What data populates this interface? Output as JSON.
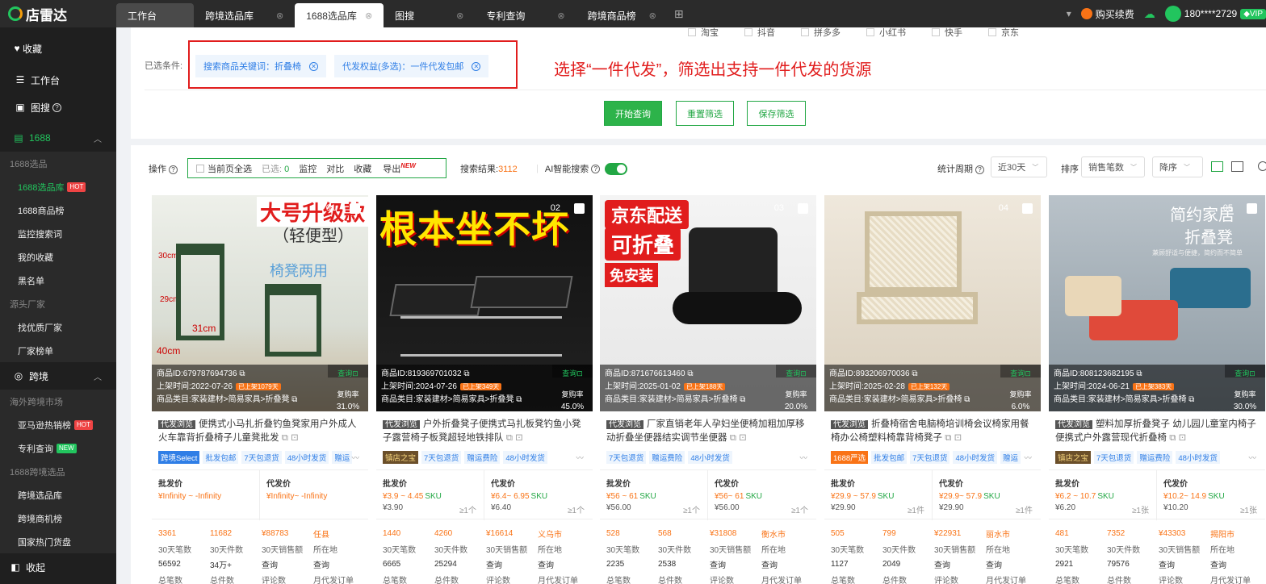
{
  "app": {
    "name": "店雷达"
  },
  "tabs": [
    {
      "label": "工作台"
    },
    {
      "label": "跨境选品库"
    },
    {
      "label": "1688选品库"
    },
    {
      "label": "图搜"
    },
    {
      "label": "专利查询"
    },
    {
      "label": "跨境商品榜"
    }
  ],
  "topright": {
    "buy": "购买续费",
    "phone": "180****2729"
  },
  "sidebar": {
    "fav": "收藏",
    "workbench": "工作台",
    "imgsearch": "图搜",
    "s1688": "1688",
    "g1": "1688选品",
    "i1": "1688选品库",
    "i2": "1688商品榜",
    "i3": "监控搜索词",
    "i4": "我的收藏",
    "i5": "黑名单",
    "g2": "源头厂家",
    "i6": "找优质厂家",
    "i7": "厂家榜单",
    "cross": "跨境",
    "g3": "海外跨境市场",
    "i8": "亚马逊热销榜",
    "i9": "专利查询",
    "g4": "1688跨境选品",
    "i10": "跨境选品库",
    "i11": "跨境商机榜",
    "i12": "国家热门货盘",
    "collapse": "收起",
    "hot": "HOT",
    "new": "NEW"
  },
  "filter": {
    "platforms": [
      "淘宝",
      "抖音",
      "拼多多",
      "小红书",
      "快手",
      "京东"
    ],
    "selected_label": "已选条件:",
    "chip1": "搜索商品关键词：折叠椅",
    "chip2": "代发权益(多选)：一件代发包邮",
    "annotation": "选择“一件代发”，筛选出支持一件代发的货源",
    "btn_query": "开始查询",
    "btn_reset": "重置筛选",
    "btn_save": "保存筛选"
  },
  "toolbar": {
    "op": "操作",
    "selectall": "当前页全选",
    "selected": "已选:",
    "selected_count": "0",
    "monitor": "监控",
    "compare": "对比",
    "fav": "收藏",
    "export": "导出",
    "new": "NEW",
    "result_label": "搜索结果:",
    "result_count": "3112",
    "ai": "AI智能搜索",
    "period": "统计周期",
    "period_val": "近30天",
    "sort": "排序",
    "sort_val": "销售笔数",
    "order_val": "降序"
  },
  "labels": {
    "pid": "商品ID:",
    "date": "上架时间:",
    "cat": "商品类目:",
    "query": "查询",
    "rate": "复购率",
    "wholesale": "批发价",
    "dropship": "代发价",
    "l_orders": "30天笔数",
    "l_pieces": "30天件数",
    "l_sales": "30天销售额",
    "l_loc": "所在地",
    "l_total": "总笔数",
    "l_totalpcs": "总件数",
    "l_reviews": "评论数",
    "l_monthly": "月代发订单"
  },
  "products": [
    {
      "idx": "01",
      "id": "679787694736",
      "date": "2022-07-26",
      "days": "已上架1079天",
      "cat": "家装建材>简易家具>折叠凳",
      "rate": "31.0%",
      "tag": "代发浏览",
      "title": "便携式小马扎折叠钓鱼凳家用户外成人火车靠背折叠椅子儿童凳批发",
      "tags": [
        "跨境Select",
        "批发包邮",
        "7天包退货",
        "48小时发货",
        "赠运"
      ],
      "wp": "¥Infinity ~ -Infinity",
      "wsku": "",
      "wu": "",
      "wm": "",
      "dp": "¥Infinity~ -Infinity",
      "dsku": "",
      "du": "",
      "dm": "",
      "o": "3361",
      "p": "11682",
      "s": "¥88783",
      "loc": "任县",
      "to": "56592",
      "tp": "34万+",
      "rv": "查询",
      "mo": "查询"
    },
    {
      "idx": "02",
      "id": "819369701032",
      "date": "2024-07-26",
      "days": "已上架349天",
      "cat": "家装建材>简易家具>折叠凳",
      "rate": "45.0%",
      "tag": "代发浏览",
      "title": "户外折叠凳子便携式马扎板凳钓鱼小凳子露营椅子板凳超轻地铁排队",
      "tags": [
        "镇店之宝",
        "7天包退货",
        "赠运费险",
        "48小时发货"
      ],
      "wp": "¥3.9 ~ 4.45",
      "wsku": "SKU",
      "wu": "¥3.90",
      "wm": "≥1个",
      "dp": "¥6.4~ 6.95",
      "dsku": "SKU",
      "du": "¥6.40",
      "dm": "≥1个",
      "o": "1440",
      "p": "4260",
      "s": "¥16614",
      "loc": "义乌市",
      "to": "6665",
      "tp": "25294",
      "rv": "查询",
      "mo": "查询"
    },
    {
      "idx": "03",
      "id": "871676613460",
      "date": "2025-01-02",
      "days": "已上架188天",
      "cat": "家装建材>简易家具>折叠椅",
      "rate": "20.0%",
      "tag": "代发浏览",
      "title": "厂家直销老年人孕妇坐便椅加粗加厚移动折叠坐便器结实调节坐便器",
      "tags": [
        "7天包退货",
        "赠运费险",
        "48小时发货"
      ],
      "wp": "¥56 ~ 61",
      "wsku": "SKU",
      "wu": "¥56.00",
      "wm": "≥1个",
      "dp": "¥56~ 61",
      "dsku": "SKU",
      "du": "¥56.00",
      "dm": "≥1个",
      "o": "528",
      "p": "568",
      "s": "¥31808",
      "loc": "衡水市",
      "to": "2235",
      "tp": "2538",
      "rv": "查询",
      "mo": "查询"
    },
    {
      "idx": "04",
      "id": "893206970036",
      "date": "2025-02-28",
      "days": "已上架132天",
      "cat": "家装建材>简易家具>折叠椅",
      "rate": "6.0%",
      "tag": "代发浏览",
      "title": "折叠椅宿舍电脑椅培训椅会议椅家用餐椅办公椅塑料椅靠背椅凳子",
      "tags": [
        "1688严选",
        "批发包邮",
        "7天包退货",
        "48小时发货",
        "赠运"
      ],
      "wp": "¥29.9 ~ 57.9",
      "wsku": "SKU",
      "wu": "¥29.90",
      "wm": "≥1件",
      "dp": "¥29.9~ 57.9",
      "dsku": "SKU",
      "du": "¥29.90",
      "dm": "≥1件",
      "o": "505",
      "p": "799",
      "s": "¥22931",
      "loc": "丽水市",
      "to": "1127",
      "tp": "2049",
      "rv": "查询",
      "mo": "查询"
    },
    {
      "idx": "05",
      "id": "808123682195",
      "date": "2024-06-21",
      "days": "已上架383天",
      "cat": "家装建材>简易家具>折叠椅",
      "rate": "30.0%",
      "tag": "代发浏览",
      "title": "塑料加厚折叠凳子 幼儿园儿童室内椅子便携式户外露营现代折叠椅",
      "tags": [
        "镇店之宝",
        "7天包退货",
        "赠运费险",
        "48小时发货"
      ],
      "wp": "¥6.2 ~ 10.7",
      "wsku": "SKU",
      "wu": "¥6.20",
      "wm": "≥1张",
      "dp": "¥10.2~ 14.9",
      "dsku": "SKU",
      "du": "¥10.20",
      "dm": "≥1张",
      "o": "481",
      "p": "7352",
      "s": "¥43303",
      "loc": "揭阳市",
      "to": "2921",
      "tp": "79576",
      "rv": "查询",
      "mo": "查询"
    }
  ],
  "images": [
    {
      "t1": "大号升级款",
      "t2": "（轻便型）",
      "t3": "椅凳两用",
      "m1": "30cm",
      "m2": "29cm",
      "m3": "31cm",
      "m4": "40cm"
    },
    {
      "t1": "根本坐不坏"
    },
    {
      "t1": "京东配送",
      "t2": "可折叠",
      "t3": "免安装"
    },
    {},
    {
      "t1": "简约家居",
      "t2": "折叠凳",
      "t3": "兼顾舒适与便捷，简约而不简单"
    }
  ]
}
